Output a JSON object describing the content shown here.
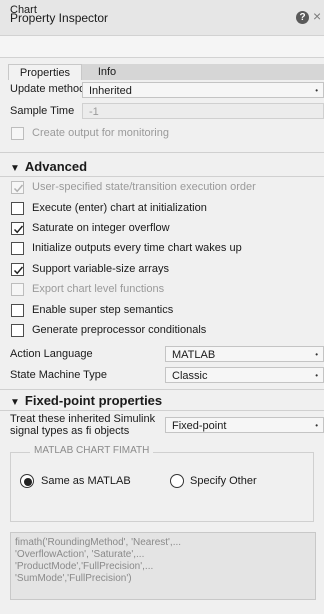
{
  "window": {
    "title": "Property Inspector"
  },
  "object_name": "Chart",
  "tabs": [
    {
      "label": "Properties"
    },
    {
      "label": "Info"
    }
  ],
  "properties": {
    "update_method": {
      "label": "Update method",
      "value": "Inherited"
    },
    "sample_time": {
      "label": "Sample Time",
      "value": "-1"
    },
    "create_output": {
      "label": "Create output for monitoring",
      "checked": false,
      "enabled": false
    }
  },
  "advanced": {
    "title": "Advanced",
    "options": [
      {
        "label": "User-specified state/transition execution order",
        "checked": true,
        "enabled": false
      },
      {
        "label": "Execute (enter) chart at initialization",
        "checked": false,
        "enabled": true
      },
      {
        "label": "Saturate on integer overflow",
        "checked": true,
        "enabled": true
      },
      {
        "label": "Initialize outputs every time chart wakes up",
        "checked": false,
        "enabled": true
      },
      {
        "label": "Support variable-size arrays",
        "checked": true,
        "enabled": true
      },
      {
        "label": "Export chart level functions",
        "checked": false,
        "enabled": false
      },
      {
        "label": "Enable super step semantics",
        "checked": false,
        "enabled": true
      },
      {
        "label": "Generate preprocessor conditionals",
        "checked": false,
        "enabled": true
      }
    ],
    "action_language": {
      "label": "Action Language",
      "value": "MATLAB"
    },
    "state_machine_type": {
      "label": "State Machine Type",
      "value": "Classic"
    }
  },
  "fixed_point": {
    "title": "Fixed-point properties",
    "treat_label_line1": "Treat these inherited Simulink",
    "treat_label_line2": "signal types as fi objects",
    "treat_value": "Fixed-point",
    "fimath_legend": "MATLAB CHART FIMATH",
    "radio_same": {
      "label": "Same as MATLAB",
      "selected": true
    },
    "radio_specify": {
      "label": "Specify Other",
      "selected": false
    },
    "fimath_lines": [
      "fimath('RoundingMethod', 'Nearest',...",
      "'OverflowAction', 'Saturate',...",
      "'ProductMode','FullPrecision',...",
      "'SumMode','FullPrecision')"
    ]
  },
  "icons": {
    "help": "help-icon",
    "close": "close-icon",
    "collapse": "triangle-down-icon",
    "check": "checkmark-icon"
  }
}
